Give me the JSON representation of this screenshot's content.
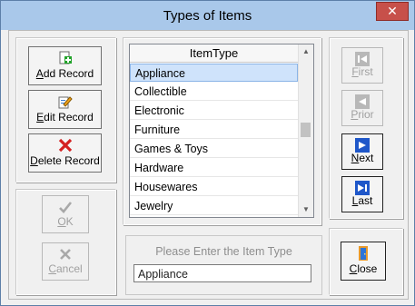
{
  "window": {
    "title": "Types of Items",
    "close_glyph": "✕"
  },
  "record_buttons": {
    "add": {
      "label": "Add Record",
      "mnemonic": "A",
      "rest": "dd Record",
      "icon": "add-record-icon"
    },
    "edit": {
      "label": "Edit Record",
      "mnemonic": "E",
      "rest": "dit Record",
      "icon": "edit-record-icon"
    },
    "delete": {
      "label": "Delete Record",
      "mnemonic": "D",
      "rest": "elete Record",
      "icon": "delete-record-icon"
    }
  },
  "confirm_buttons": {
    "ok": {
      "label": "OK",
      "mnemonic": "O",
      "rest": "K",
      "state": "disabled",
      "icon": "check-icon"
    },
    "cancel": {
      "label": "Cancel",
      "mnemonic": "C",
      "rest": "ancel",
      "state": "disabled",
      "icon": "x-icon"
    }
  },
  "grid": {
    "header": "ItemType",
    "rows": [
      "Appliance",
      "Collectible",
      "Electronic",
      "Furniture",
      "Games & Toys",
      "Hardware",
      "Housewares",
      "Jewelry"
    ],
    "selected_index": 0
  },
  "entry": {
    "label": "Please Enter the Item Type",
    "value": "Appliance"
  },
  "nav_buttons": {
    "first": {
      "label": "First",
      "mnemonic": "F",
      "rest": "irst",
      "state": "disabled"
    },
    "prior": {
      "label": "Prior",
      "mnemonic": "P",
      "rest": "rior",
      "state": "disabled"
    },
    "next": {
      "label": "Next",
      "mnemonic": "N",
      "rest": "ext",
      "state": "enabled"
    },
    "last": {
      "label": "Last",
      "mnemonic": "L",
      "rest": "ast",
      "state": "enabled"
    },
    "close": {
      "label": "Close",
      "mnemonic": "C",
      "rest": "lose",
      "state": "enabled"
    }
  },
  "colors": {
    "title_bar": "#a9c8ea",
    "selection": "#cfe3fb",
    "close_button": "#c7504a",
    "disabled_text": "#a0a0a0"
  }
}
